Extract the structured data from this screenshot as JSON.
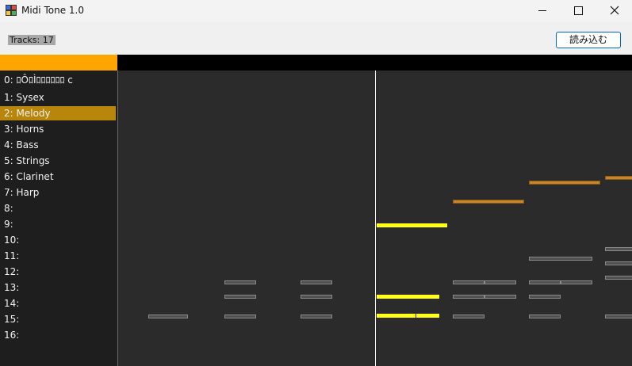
{
  "window": {
    "title": "Midi Tone 1.0"
  },
  "toolbar": {
    "tracks_label": "Tracks: 17",
    "load_label": "読み込む"
  },
  "colors": {
    "accent": "#ffa500",
    "selected_track": "#b8860b",
    "active_note": "#ffff1a",
    "orange_note": "#c8862a",
    "inactive_note": "#505050"
  },
  "tracks": [
    {
      "label": "0: ﾛÔﾛÌﾛﾛﾛﾛﾛﾛ c"
    },
    {
      "label": "1: Sysex"
    },
    {
      "label": "2: Melody",
      "selected": true
    },
    {
      "label": "3: Horns"
    },
    {
      "label": "4: Bass"
    },
    {
      "label": "5: Strings"
    },
    {
      "label": "6: Clarinet"
    },
    {
      "label": "7: Harp"
    },
    {
      "label": "8:"
    },
    {
      "label": "9:"
    },
    {
      "label": "10:"
    },
    {
      "label": "11:"
    },
    {
      "label": "12:"
    },
    {
      "label": "13:"
    },
    {
      "label": "14:"
    },
    {
      "label": "15:"
    },
    {
      "label": "16:"
    }
  ]
}
